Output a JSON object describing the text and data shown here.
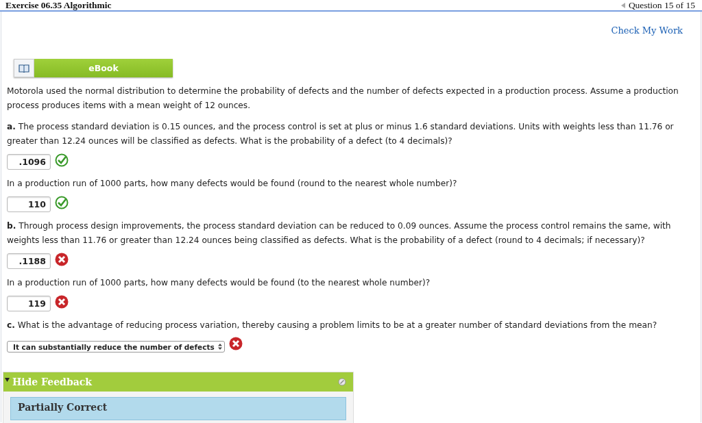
{
  "header": {
    "title": "Exercise 06.35 Algorithmic",
    "question": "Question 15 of 15"
  },
  "check_link": "Check My Work",
  "ebook": {
    "label": "eBook"
  },
  "items": [
    {
      "kind": "text",
      "text": "Motorola used the normal distribution to determine the probability of defects and the number of defects expected in a production process. Assume a production process produces items with a mean weight of 12 ounces."
    },
    {
      "kind": "text",
      "text": "**a.** The process standard deviation is 0.15 ounces, and the process control is set at plus or minus 1.6 standard deviations. Units with weights less than 11.76 or greater than 12.24 ounces will be classified as defects. What is the probability of a defect (to 4 decimals)?"
    },
    {
      "kind": "input",
      "value": ".1096",
      "correct": true
    },
    {
      "kind": "text",
      "text": "In a production run of 1000 parts, how many defects would be found (round to the nearest whole number)?"
    },
    {
      "kind": "input",
      "value": "110",
      "correct": true
    },
    {
      "kind": "text",
      "text": "**b.** Through process design improvements, the process standard deviation can be reduced to 0.09 ounces. Assume the process control remains the same, with weights less than 11.76 or greater than 12.24 ounces being classified as defects. What is the probability of a defect (round to 4 decimals; if necessary)?"
    },
    {
      "kind": "input",
      "value": ".1188",
      "correct": false
    },
    {
      "kind": "text",
      "text": "In a production run of 1000 parts, how many defects would be found (to the nearest whole number)?"
    },
    {
      "kind": "input",
      "value": "119",
      "correct": false
    },
    {
      "kind": "text",
      "text": "**c.** What is the advantage of reducing process variation, thereby causing a problem limits to be at a greater number of standard deviations from the mean?"
    },
    {
      "kind": "select",
      "value": "It can substantially reduce the number of defects",
      "correct": false
    }
  ],
  "feedback": {
    "toggle": "Hide Feedback",
    "expanded": true,
    "result": "Partially Correct"
  }
}
